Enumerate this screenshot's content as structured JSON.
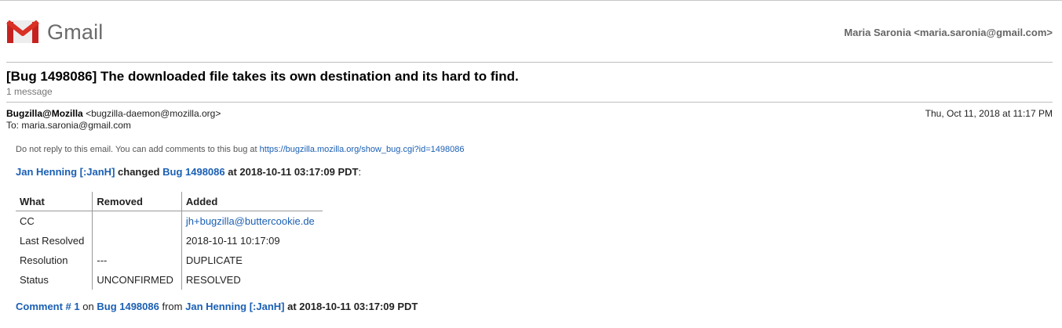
{
  "app": {
    "logo_text": "Gmail"
  },
  "account": "Maria Saronia <maria.saronia@gmail.com>",
  "thread": {
    "subject": "[Bug 1498086] The downloaded file takes its own destination and its hard to find.",
    "message_count": "1 message"
  },
  "message": {
    "from_name": "Bugzilla@Mozilla",
    "from_email": "<bugzilla-daemon@mozilla.org>",
    "to": "To: maria.saronia@gmail.com",
    "date": "Thu, Oct 11, 2018 at 11:17 PM"
  },
  "body": {
    "notice_text": "Do not reply to this email. You can add comments to this bug at",
    "notice_link": "https://bugzilla.mozilla.org/show_bug.cgi?id=1498086",
    "changer": "Jan Henning [:JanH]",
    "changed_word": "changed",
    "bug_link": "Bug 1498086",
    "at_time": "at 2018-10-11 03:17:09 PDT",
    "colon": ":",
    "table": {
      "headers": [
        "What",
        "Removed",
        "Added"
      ],
      "rows": [
        {
          "what": "CC",
          "removed": "",
          "added": "jh+bugzilla@buttercookie.de"
        },
        {
          "what": "Last Resolved",
          "removed": "",
          "added": "2018-10-11 10:17:09"
        },
        {
          "what": "Resolution",
          "removed": "---",
          "added": "DUPLICATE"
        },
        {
          "what": "Status",
          "removed": "UNCONFIRMED",
          "added": "RESOLVED"
        }
      ]
    },
    "comment": {
      "label": "Comment # 1",
      "on": "on",
      "bug": "Bug 1498086",
      "from": "from",
      "author": "Jan Henning [:JanH]",
      "at_time": "at 2018-10-11 03:17:09 PDT"
    }
  },
  "colors": {
    "link": "#1a5fb4",
    "gmail_red": "#d93025"
  }
}
